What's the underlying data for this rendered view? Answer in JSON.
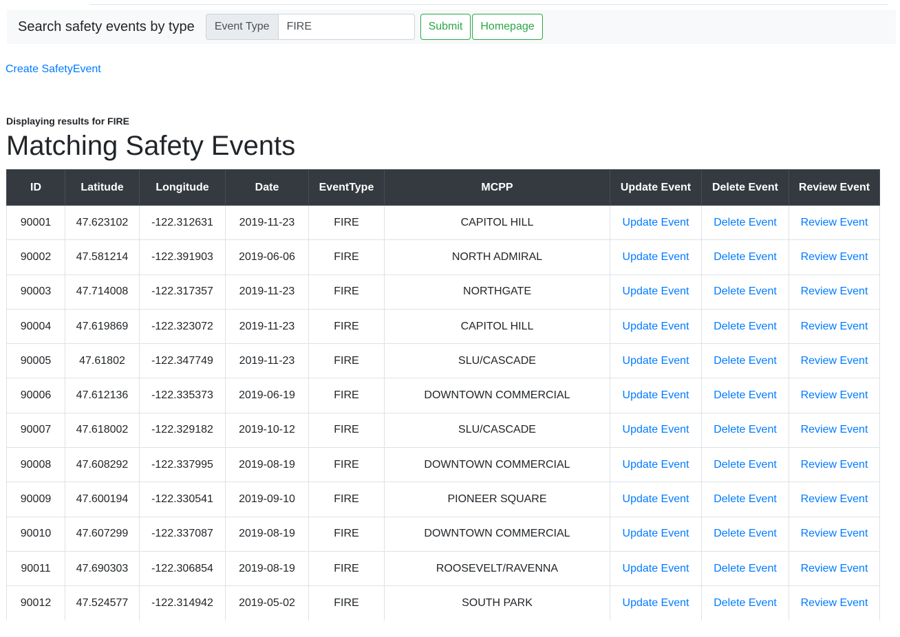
{
  "navbar": {
    "brand": "Search safety events by type",
    "search_prepend": "Event Type",
    "search_value": "FIRE",
    "submit_label": "Submit",
    "homepage_label": "Homepage"
  },
  "create_link": "Create SafetyEvent",
  "results_note": "Displaying results for FIRE",
  "page_title": "Matching Safety Events",
  "colors": {
    "link": "#007bff",
    "success": "#28a745",
    "table_header_bg": "#343a40",
    "navbar_bg": "#f8f9fa"
  },
  "table": {
    "headers": [
      "ID",
      "Latitude",
      "Longitude",
      "Date",
      "EventType",
      "MCPP",
      "Update Event",
      "Delete Event",
      "Review Event"
    ],
    "rows": [
      {
        "id": "90001",
        "lat": "47.623102",
        "lon": "-122.312631",
        "date": "2019-11-23",
        "type": "FIRE",
        "mcpp": "CAPITOL HILL",
        "update": "Update Event",
        "delete": "Delete Event",
        "review": "Review Event"
      },
      {
        "id": "90002",
        "lat": "47.581214",
        "lon": "-122.391903",
        "date": "2019-06-06",
        "type": "FIRE",
        "mcpp": "NORTH ADMIRAL",
        "update": "Update Event",
        "delete": "Delete Event",
        "review": "Review Event"
      },
      {
        "id": "90003",
        "lat": "47.714008",
        "lon": "-122.317357",
        "date": "2019-11-23",
        "type": "FIRE",
        "mcpp": "NORTHGATE",
        "update": "Update Event",
        "delete": "Delete Event",
        "review": "Review Event"
      },
      {
        "id": "90004",
        "lat": "47.619869",
        "lon": "-122.323072",
        "date": "2019-11-23",
        "type": "FIRE",
        "mcpp": "CAPITOL HILL",
        "update": "Update Event",
        "delete": "Delete Event",
        "review": "Review Event"
      },
      {
        "id": "90005",
        "lat": "47.61802",
        "lon": "-122.347749",
        "date": "2019-11-23",
        "type": "FIRE",
        "mcpp": "SLU/CASCADE",
        "update": "Update Event",
        "delete": "Delete Event",
        "review": "Review Event"
      },
      {
        "id": "90006",
        "lat": "47.612136",
        "lon": "-122.335373",
        "date": "2019-06-19",
        "type": "FIRE",
        "mcpp": "DOWNTOWN COMMERCIAL",
        "update": "Update Event",
        "delete": "Delete Event",
        "review": "Review Event"
      },
      {
        "id": "90007",
        "lat": "47.618002",
        "lon": "-122.329182",
        "date": "2019-10-12",
        "type": "FIRE",
        "mcpp": "SLU/CASCADE",
        "update": "Update Event",
        "delete": "Delete Event",
        "review": "Review Event"
      },
      {
        "id": "90008",
        "lat": "47.608292",
        "lon": "-122.337995",
        "date": "2019-08-19",
        "type": "FIRE",
        "mcpp": "DOWNTOWN COMMERCIAL",
        "update": "Update Event",
        "delete": "Delete Event",
        "review": "Review Event"
      },
      {
        "id": "90009",
        "lat": "47.600194",
        "lon": "-122.330541",
        "date": "2019-09-10",
        "type": "FIRE",
        "mcpp": "PIONEER SQUARE",
        "update": "Update Event",
        "delete": "Delete Event",
        "review": "Review Event"
      },
      {
        "id": "90010",
        "lat": "47.607299",
        "lon": "-122.337087",
        "date": "2019-08-19",
        "type": "FIRE",
        "mcpp": "DOWNTOWN COMMERCIAL",
        "update": "Update Event",
        "delete": "Delete Event",
        "review": "Review Event"
      },
      {
        "id": "90011",
        "lat": "47.690303",
        "lon": "-122.306854",
        "date": "2019-08-19",
        "type": "FIRE",
        "mcpp": "ROOSEVELT/RAVENNA",
        "update": "Update Event",
        "delete": "Delete Event",
        "review": "Review Event"
      },
      {
        "id": "90012",
        "lat": "47.524577",
        "lon": "-122.314942",
        "date": "2019-05-02",
        "type": "FIRE",
        "mcpp": "SOUTH PARK",
        "update": "Update Event",
        "delete": "Delete Event",
        "review": "Review Event"
      }
    ]
  }
}
